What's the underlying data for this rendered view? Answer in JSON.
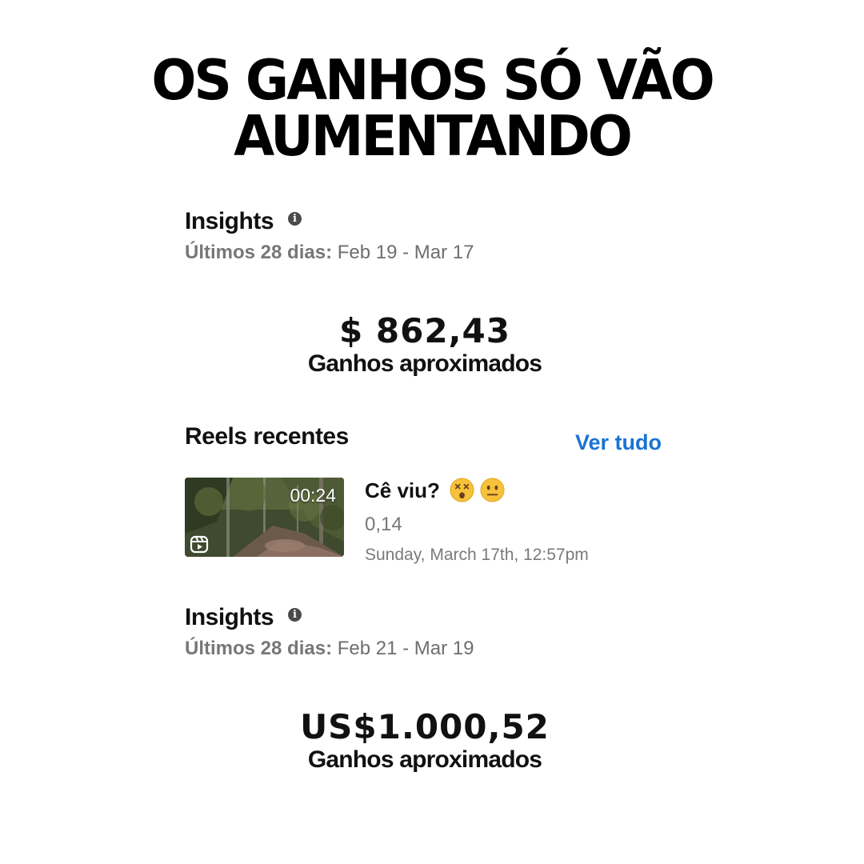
{
  "headline": {
    "line1": "OS GANHOS SÓ VÃO",
    "line2": "AUMENTANDO"
  },
  "insights_1": {
    "title": "Insights",
    "info_icon": "info-icon",
    "period_label": "Últimos 28 dias:",
    "period_range": " Feb 19 - Mar 17",
    "amount": "$ 862,43",
    "amount_caption": "Ganhos aproximados"
  },
  "reels": {
    "title": "Reels recentes",
    "see_all": "Ver tudo",
    "see_all_color": "#1a73d1",
    "items": [
      {
        "duration": "00:24",
        "type_icon": "reels-icon",
        "title": "Cê viu?",
        "emojis": [
          "dizzy-face-emoji",
          "neutral-face-emoji"
        ],
        "value": "0,14",
        "date": "Sunday, March 17th, 12:57pm"
      }
    ]
  },
  "insights_2": {
    "title": "Insights",
    "info_icon": "info-icon",
    "period_label": "Últimos 28 dias:",
    "period_range": " Feb 21 - Mar 19",
    "amount": "US$1.000,52",
    "amount_caption": "Ganhos aproximados"
  }
}
